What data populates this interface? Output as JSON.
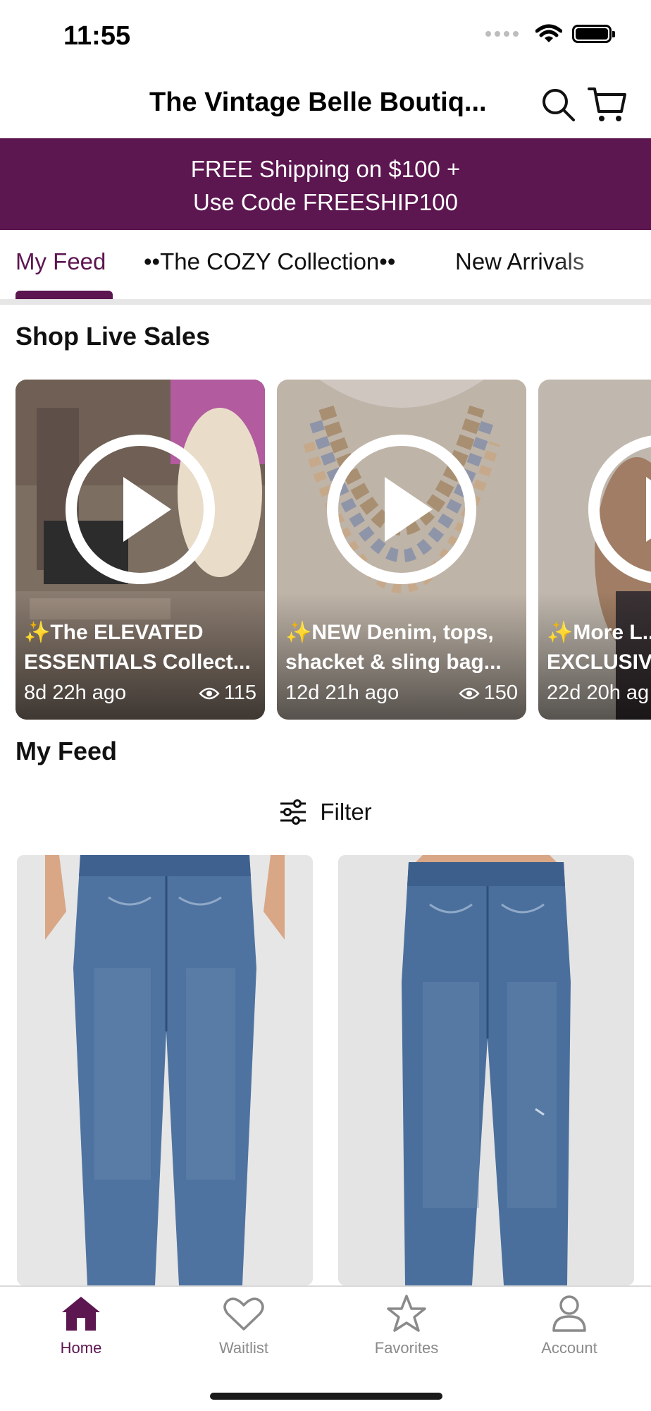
{
  "status_bar": {
    "time": "11:55"
  },
  "header": {
    "title": "The Vintage Belle Boutiq..."
  },
  "promo": {
    "line1": "FREE Shipping on $100 +",
    "line2": "Use Code FREESHIP100"
  },
  "tabs": [
    {
      "label": "My Feed",
      "active": true
    },
    {
      "label": "••The COZY Collection••",
      "active": false
    },
    {
      "label": "New Arrivals",
      "active": false
    }
  ],
  "live_sales": {
    "title": "Shop Live Sales",
    "cards": [
      {
        "title_line1": "The ELEVATED",
        "title_line2": "ESSENTIALS Collect...",
        "age": "8d 22h ago",
        "views": "115"
      },
      {
        "title_line1": "NEW Denim, tops,",
        "title_line2": "shacket & sling bag...",
        "age": "12d 21h ago",
        "views": "150"
      },
      {
        "title_line1": "More L...",
        "title_line2": "EXCLUSIVE",
        "age": "22d 20h ag",
        "views": ""
      }
    ]
  },
  "feed": {
    "title": "My Feed",
    "filter_label": "Filter"
  },
  "bottom_nav": [
    {
      "label": "Home",
      "icon": "home-icon",
      "active": true
    },
    {
      "label": "Waitlist",
      "icon": "heart-icon",
      "active": false
    },
    {
      "label": "Favorites",
      "icon": "star-icon",
      "active": false
    },
    {
      "label": "Account",
      "icon": "person-icon",
      "active": false
    }
  ],
  "colors": {
    "brand": "#5c1650",
    "inactive": "#8a8a8a"
  }
}
